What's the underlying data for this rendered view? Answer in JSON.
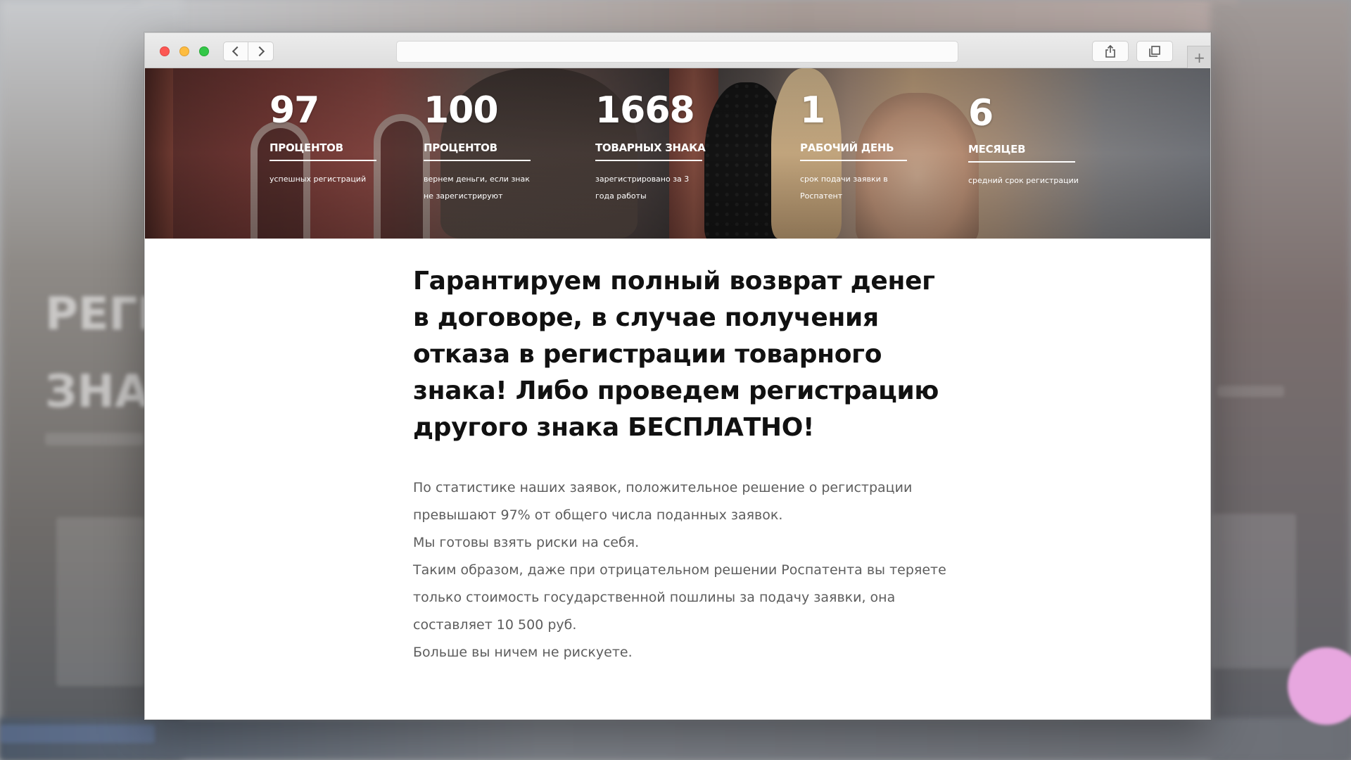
{
  "stats": [
    {
      "number": "97",
      "label": "ПРОЦЕНТОВ",
      "desc": "успешных регистраций"
    },
    {
      "number": "100",
      "label": "ПРОЦЕНТОВ",
      "desc": "вернем деньги, если знак не зарегистрируют"
    },
    {
      "number": "1668",
      "label": "ТОВАРНЫХ ЗНАКА",
      "desc": "зарегистрировано за 3 года работы"
    },
    {
      "number": "1",
      "label": "РАБОЧИЙ ДЕНЬ",
      "desc": "срок подачи заявки в Роспатент"
    },
    {
      "number": "6",
      "label": "МЕСЯЦЕВ",
      "desc": "средний срок регистрации"
    }
  ],
  "headline": "Гарантируем полный возврат денег в договоре, в случае получения отказа в регистрации товарного знака! Либо проведем регистрацию другого знака БЕСПЛАТНО!",
  "body": {
    "p1": "По статистике наших заявок, положительное решение о регистрации превышают 97% от общего числа поданных заявок.",
    "p2": "Мы готовы взять риски на себя.",
    "p3": "Таким образом, даже при отрицательном решении Роспатента вы теряете только стоимость государственной пошлины за подачу заявки, она составляет 10 500 руб.",
    "p4": "Больше вы ничем не рискуете."
  },
  "toolbar": {
    "plus_label": "+",
    "icons": [
      "chevron-left-icon",
      "chevron-right-icon",
      "share-icon",
      "tabs-icon",
      "plus-icon"
    ]
  },
  "colors": {
    "close": "#fc5753",
    "minimize": "#fdbc40",
    "maximize": "#33c748",
    "headline": "#111111",
    "body": "#5d5d5d"
  }
}
